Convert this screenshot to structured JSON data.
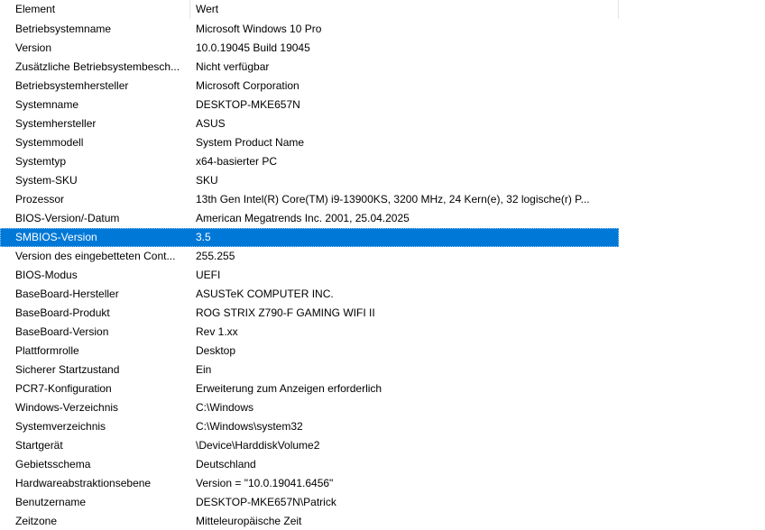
{
  "colors": {
    "selection": "#0078d7",
    "selection_text": "#ffffff",
    "header_divider": "#e5e5e5"
  },
  "columns": {
    "element": "Element",
    "value": "Wert"
  },
  "selected_index": 12,
  "rows": [
    {
      "element": "Betriebsystemname",
      "value": "Microsoft Windows 10 Pro"
    },
    {
      "element": "Version",
      "value": "10.0.19045 Build 19045"
    },
    {
      "element": "Zusätzliche Betriebsystembesch...",
      "value": "Nicht verfügbar"
    },
    {
      "element": "Betriebsystemhersteller",
      "value": "Microsoft Corporation"
    },
    {
      "element": "Systemname",
      "value": "DESKTOP-MKE657N"
    },
    {
      "element": "Systemhersteller",
      "value": "ASUS"
    },
    {
      "element": "Systemmodell",
      "value": "System Product Name"
    },
    {
      "element": "Systemtyp",
      "value": "x64-basierter PC"
    },
    {
      "element": "System-SKU",
      "value": "SKU"
    },
    {
      "element": "Prozessor",
      "value": "13th Gen Intel(R) Core(TM) i9-13900KS, 3200 MHz, 24 Kern(e), 32 logische(r) P..."
    },
    {
      "element": "BIOS-Version/-Datum",
      "value": "American Megatrends Inc. 2001, 25.04.2025"
    },
    {
      "element": "SMBIOS-Version",
      "value": "3.5"
    },
    {
      "element": "Version des eingebetteten Cont...",
      "value": "255.255"
    },
    {
      "element": "BIOS-Modus",
      "value": "UEFI"
    },
    {
      "element": "BaseBoard-Hersteller",
      "value": "ASUSTeK COMPUTER INC."
    },
    {
      "element": "BaseBoard-Produkt",
      "value": "ROG STRIX Z790-F GAMING WIFI II"
    },
    {
      "element": "BaseBoard-Version",
      "value": "Rev 1.xx"
    },
    {
      "element": "Plattformrolle",
      "value": "Desktop"
    },
    {
      "element": "Sicherer Startzustand",
      "value": "Ein"
    },
    {
      "element": "PCR7-Konfiguration",
      "value": "Erweiterung zum Anzeigen erforderlich"
    },
    {
      "element": "Windows-Verzeichnis",
      "value": "C:\\Windows"
    },
    {
      "element": "Systemverzeichnis",
      "value": "C:\\Windows\\system32"
    },
    {
      "element": "Startgerät",
      "value": "\\Device\\HarddiskVolume2"
    },
    {
      "element": "Gebietsschema",
      "value": "Deutschland"
    },
    {
      "element": "Hardwareabstraktionsebene",
      "value": "Version = \"10.0.19041.6456\""
    },
    {
      "element": "Benutzername",
      "value": "DESKTOP-MKE657N\\Patrick"
    },
    {
      "element": "Zeitzone",
      "value": "Mitteleuropäische Zeit"
    }
  ]
}
